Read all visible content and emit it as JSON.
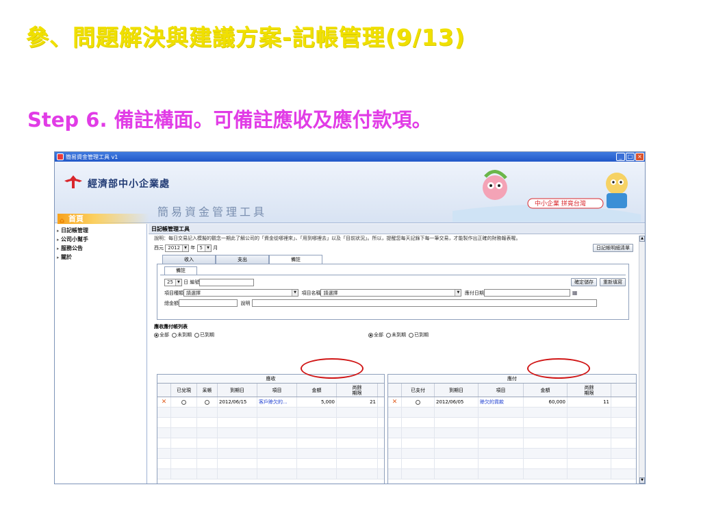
{
  "slide": {
    "title": "參、問題解決與建議方案-記帳管理(9/13)",
    "subtitle": "Step 6. 備註構面。可備註應收及應付款項。"
  },
  "window": {
    "title": "簡易資金管理工具 v1",
    "controls": [
      "_",
      "□",
      "×"
    ]
  },
  "banner": {
    "org": "經濟部中小企業處",
    "tool": "簡易資金管理工具",
    "home": "首頁",
    "slogan": "中小企業 拼竟台灣"
  },
  "sidebar": {
    "items": [
      {
        "label": "日記帳管理"
      },
      {
        "label": "公司小幫手"
      },
      {
        "label": "服務公告"
      },
      {
        "label": "關於"
      }
    ]
  },
  "main": {
    "header": "日記帳管理工具",
    "description": "說明：每日交易記入模擬的觀念一期此了解公司的「資金從哪裡來」、「用到哪裡去」以及「目前狀況」。所以，提醒您每天記錄下每一筆交易，才能製作出正確的財務報表喔。",
    "year_prefix": "西元",
    "year": "2012",
    "year_suffix": "年",
    "month": "5",
    "month_suffix": "月",
    "detail_button": "日記帳明細清單",
    "tabs": [
      "收入",
      "支出",
      "備註"
    ],
    "active_tab": "備註",
    "inner_tab": "備註",
    "form": {
      "day": "25",
      "day_label": "日",
      "number_label": "編號",
      "item_type_label": "項目種類",
      "item_type_value": "請選擇",
      "item_name_label": "項目名稱",
      "item_name_value": "請選擇",
      "payment_date_label": "應付日期",
      "total_label": "總金額",
      "note_label": "說明",
      "save_button": "確定儲存",
      "reset_button": "重新填寫"
    },
    "list_title": "應收應付帳列表",
    "filters": [
      "全部",
      "未到期",
      "已到期"
    ],
    "receivable": {
      "caption": "應收",
      "columns": [
        "",
        "已兌現",
        "呆帳",
        "到期日",
        "項目",
        "金額",
        "尚餘\n期限"
      ],
      "rows": [
        {
          "due": "2012/06/15",
          "item": "客戶賒欠的...",
          "amount": "5,000",
          "days": "21"
        }
      ]
    },
    "payable": {
      "caption": "應付",
      "columns": [
        "",
        "已支付",
        "到期日",
        "項目",
        "金額",
        "尚餘\n期限"
      ],
      "rows": [
        {
          "due": "2012/06/05",
          "item": "賒欠的貨款",
          "amount": "60,000",
          "days": "11"
        }
      ]
    }
  },
  "colors": {
    "title": "#f0e000",
    "subtitle": "#e13ce6",
    "highlight_circle": "#d01515"
  }
}
